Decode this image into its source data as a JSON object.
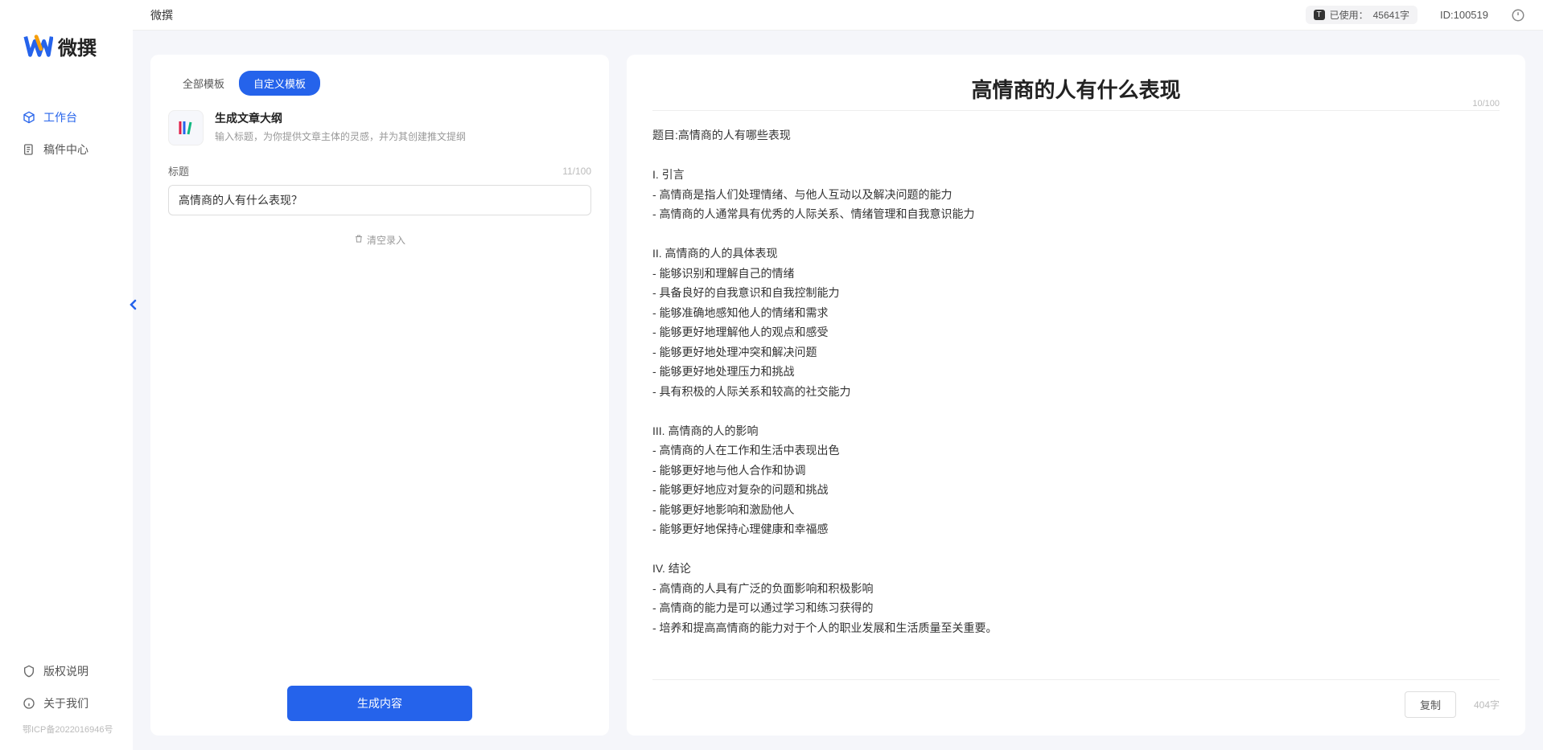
{
  "brand": {
    "name": "微撰"
  },
  "sidebar": {
    "nav": [
      {
        "label": "工作台",
        "active": true
      },
      {
        "label": "稿件中心",
        "active": false
      }
    ],
    "bottom": [
      {
        "label": "版权说明"
      },
      {
        "label": "关于我们"
      }
    ],
    "icp": "鄂ICP备2022016946号"
  },
  "topbar": {
    "title": "微撰",
    "usage_prefix": "已使用：",
    "usage_value": "45641字",
    "usage_badge": "T",
    "user_id": "ID:100519"
  },
  "left": {
    "tabs": [
      {
        "label": "全部模板",
        "active": false
      },
      {
        "label": "自定义模板",
        "active": true
      }
    ],
    "template": {
      "title": "生成文章大纲",
      "desc": "输入标题，为你提供文章主体的灵感，并为其创建推文提纲"
    },
    "title_label": "标题",
    "title_count": "11/100",
    "title_value": "高情商的人有什么表现？",
    "clear_label": "清空录入",
    "generate_label": "生成内容"
  },
  "right": {
    "title": "高情商的人有什么表现",
    "title_count": "10/100",
    "body": "题目:高情商的人有哪些表现\n\nI. 引言\n- 高情商是指人们处理情绪、与他人互动以及解决问题的能力\n- 高情商的人通常具有优秀的人际关系、情绪管理和自我意识能力\n\nII. 高情商的人的具体表现\n- 能够识别和理解自己的情绪\n- 具备良好的自我意识和自我控制能力\n- 能够准确地感知他人的情绪和需求\n- 能够更好地理解他人的观点和感受\n- 能够更好地处理冲突和解决问题\n- 能够更好地处理压力和挑战\n- 具有积极的人际关系和较高的社交能力\n\nIII. 高情商的人的影响\n- 高情商的人在工作和生活中表现出色\n- 能够更好地与他人合作和协调\n- 能够更好地应对复杂的问题和挑战\n- 能够更好地影响和激励他人\n- 能够更好地保持心理健康和幸福感\n\nIV. 结论\n- 高情商的人具有广泛的负面影响和积极影响\n- 高情商的能力是可以通过学习和练习获得的\n- 培养和提高高情商的能力对于个人的职业发展和生活质量至关重要。",
    "copy_label": "复制",
    "word_count": "404字"
  }
}
